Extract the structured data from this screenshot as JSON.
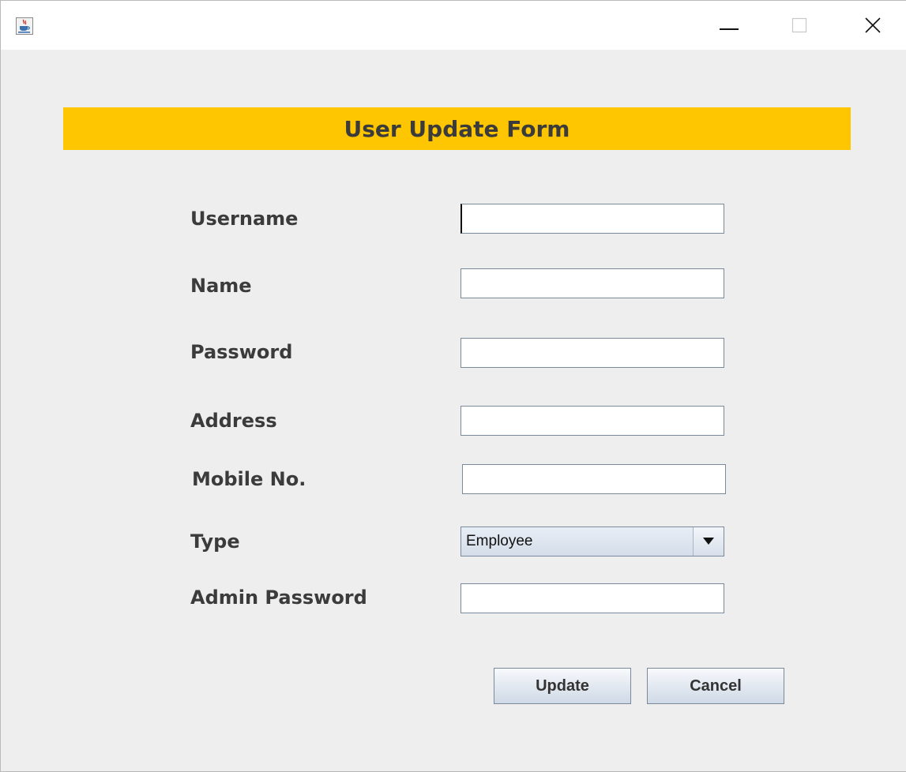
{
  "window": {
    "icons": {
      "app": "java-app-icon",
      "minimize": "minimize-icon",
      "maximize": "maximize-icon",
      "close": "close-icon"
    }
  },
  "form": {
    "title": "User Update Form",
    "banner_color": "#fdc600",
    "fields": [
      {
        "label": "Username",
        "value": "",
        "focused": true
      },
      {
        "label": "Name",
        "value": ""
      },
      {
        "label": "Password",
        "value": ""
      },
      {
        "label": "Address",
        "value": ""
      },
      {
        "label": "Mobile No.",
        "value": ""
      },
      {
        "label": "Type",
        "selected": "Employee",
        "control": "dropdown"
      },
      {
        "label": "Admin Password",
        "value": ""
      }
    ],
    "buttons": {
      "update": "Update",
      "cancel": "Cancel"
    }
  }
}
